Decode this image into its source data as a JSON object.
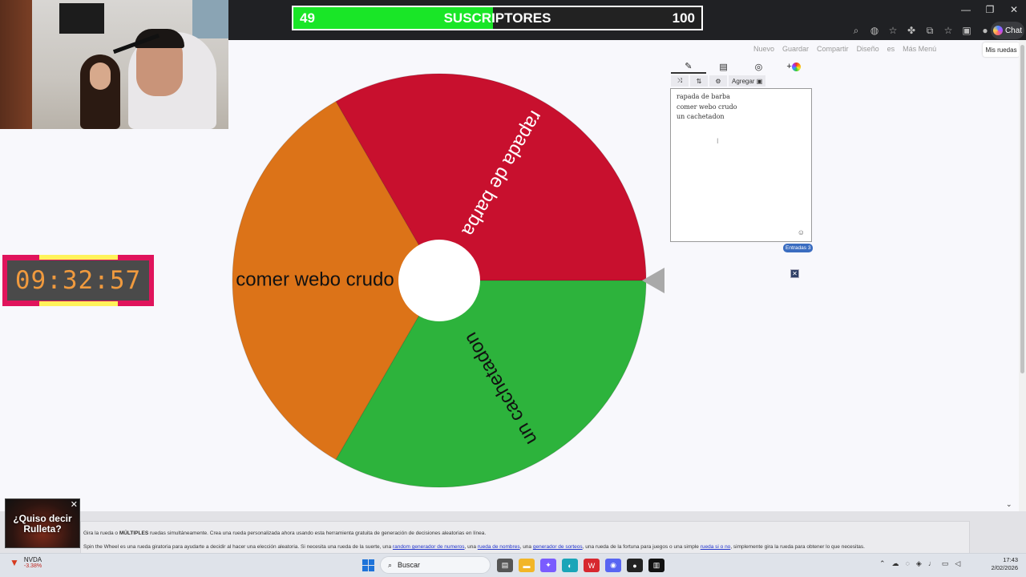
{
  "subscriber_bar": {
    "current": "49",
    "title": "SUSCRIPTORES",
    "goal": "100",
    "progress_fraction": 0.49
  },
  "timer": {
    "time": "09:32:57"
  },
  "browser": {
    "chat_label": "Chat"
  },
  "page_toolbar": {
    "items": [
      "Nuevo",
      "Guardar",
      "Compartir",
      "Diseño",
      "es",
      "Más Menú"
    ],
    "my_wheels": "Mis ruedas"
  },
  "wheel": {
    "segments": [
      {
        "label": "rapada de barba",
        "color": "#c8102e"
      },
      {
        "label": "un cachetadon",
        "color": "#2db33c"
      },
      {
        "label": "comer webo crudo",
        "color": "#dc7318"
      }
    ]
  },
  "entries_panel": {
    "entries": [
      "rapada de barba",
      "comer webo crudo",
      "un cachetadon"
    ],
    "add_label": "Agregar",
    "count_badge": "Entradas 3"
  },
  "suggestion_popup": {
    "text_line1": "¿Quiso decir",
    "text_line2": "Rulleta?"
  },
  "info": {
    "line1_pre": "Gira la rueda o ",
    "line1_bold": "MÚLTIPLES",
    "line1_post": " ruedas simultáneamente. Crea una rueda personalizada ahora usando esta herramienta gratuita de generación de decisiones aleatorias en línea.",
    "line2_a": "Spin the Wheel es una rueda giratoria para ayudarte a decidir al hacer una elección aleatoria. Si necesita una rueda de la suerte, una ",
    "link1": "random generador de numeros",
    "line2_b": ", una ",
    "link2": "rueda de nombres",
    "line2_c": ", una ",
    "link3": "generador de sorteos",
    "line2_d": ", una rueda de la fortuna para juegos o una simple ",
    "link4": "rueda si o no",
    "line2_e": ", simplemente gira la rueda para obtener lo que necesitas."
  },
  "taskbar": {
    "stock_name": "NVDA",
    "stock_change": "-3.38%",
    "search_placeholder": "Buscar",
    "time": "17:43",
    "date": "2/02/2026"
  }
}
